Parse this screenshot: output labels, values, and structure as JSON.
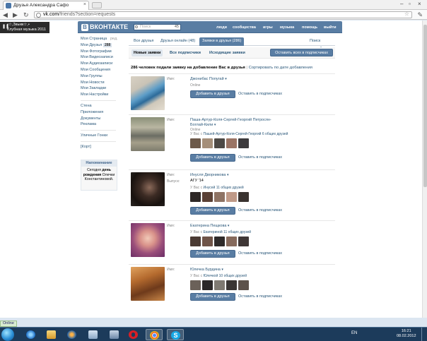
{
  "browser": {
    "tab_title": "Друзья Александра Сафо",
    "url_domain": "vk.com",
    "url_path": "/friends?section=requests"
  },
  "music_widget": {
    "line1": "•☆,Звыкк☆,•",
    "line2": "Клубная музыка 2011"
  },
  "vk": {
    "logo": "ВКОНТАКТЕ",
    "search_placeholder": "Поиск",
    "search_count": "45",
    "topmenu": [
      "люди",
      "сообщества",
      "игры",
      "музыка",
      "помощь",
      "выйти"
    ]
  },
  "left_menu": {
    "items": [
      {
        "label": "Моя Страница",
        "extra": "ред."
      },
      {
        "label": "Мои Друзья",
        "badge": "288"
      },
      {
        "label": "Мои Фотографии"
      },
      {
        "label": "Мои Видеозаписи"
      },
      {
        "label": "Мои Аудиозаписи"
      },
      {
        "label": "Мои Сообщения"
      },
      {
        "label": "Мои Группы"
      },
      {
        "label": "Мои Новости"
      },
      {
        "label": "Мои Закладки"
      },
      {
        "label": "Мои Настройки"
      }
    ],
    "items2": [
      "Стена",
      "Приложения",
      "Документы",
      "Реклама"
    ],
    "items3": [
      "Уличные Гонки"
    ],
    "items4": [
      "[Корт]"
    ]
  },
  "reminder": {
    "title": "Напоминание",
    "text_pre": "Сегодня",
    "text_bold": "день рождения",
    "text_post": "Олечки Константиновой."
  },
  "friend_tabs": {
    "all": "Все друзья",
    "online": "Друзья онлайн (48)",
    "requests": "Заявки в друзья (286)",
    "search": "Поиск друзей"
  },
  "sub_tabs": {
    "new": "Новые заявки",
    "all_subs": "Все подписчики",
    "outgoing": "Исходящие заявки",
    "leave_all": "Оставить всех в подписчиках"
  },
  "summary": {
    "text": "286 человек подали заявку на добавление Вас в друзья",
    "sort": "Сортировать по дате добавления"
  },
  "labels": {
    "name": "Имя:",
    "graduation": "Выпуск:",
    "add": "Добавить в друзья",
    "keep": "Оставить в подписчиках"
  },
  "requests": [
    {
      "name": "Джонибас Попугай",
      "status": "Online",
      "mutual": "",
      "school": ""
    },
    {
      "name": "Паша-Артур-Коля-Сергей-Георгий Петросян-Боглай-Кили",
      "status": "Online",
      "mutual_pre": "У Вас с",
      "mutual_name": "Пашей-Артур-Коля-Сергей-Георгий",
      "mutual_count": "6 общих друзей",
      "school": ""
    },
    {
      "name": "Инусля Дворникова",
      "status": "",
      "mutual_pre": "У Вас с",
      "mutual_name": "Инусей",
      "mutual_count": "11 общих друзей",
      "school": "АГУ '14"
    },
    {
      "name": "Екатерина Пещкова",
      "status": "",
      "mutual_pre": "У Вас с",
      "mutual_name": "Екатериной",
      "mutual_count": "11 общих друзей",
      "school": ""
    },
    {
      "name": "Юлечка Бурдина",
      "status": "",
      "mutual_pre": "У Вас с",
      "mutual_name": "Юлечкой",
      "mutual_count": "10 общих друзей",
      "school": ""
    }
  ],
  "status_bar": "Online",
  "taskbar": {
    "lang": "EN",
    "time": "16:21",
    "date": "08.02.2012"
  },
  "colors": {
    "vk_blue": "#597da3",
    "link": "#2b587a",
    "taskbar": "#1c3b5b"
  },
  "icons": [
    "close-icon",
    "back-icon",
    "forward-icon",
    "reload-icon",
    "star-icon",
    "wrench-icon",
    "search-icon",
    "windows-start-icon",
    "ie-icon",
    "explorer-icon",
    "media-player-icon",
    "opera-icon",
    "chrome-icon",
    "skype-icon"
  ]
}
